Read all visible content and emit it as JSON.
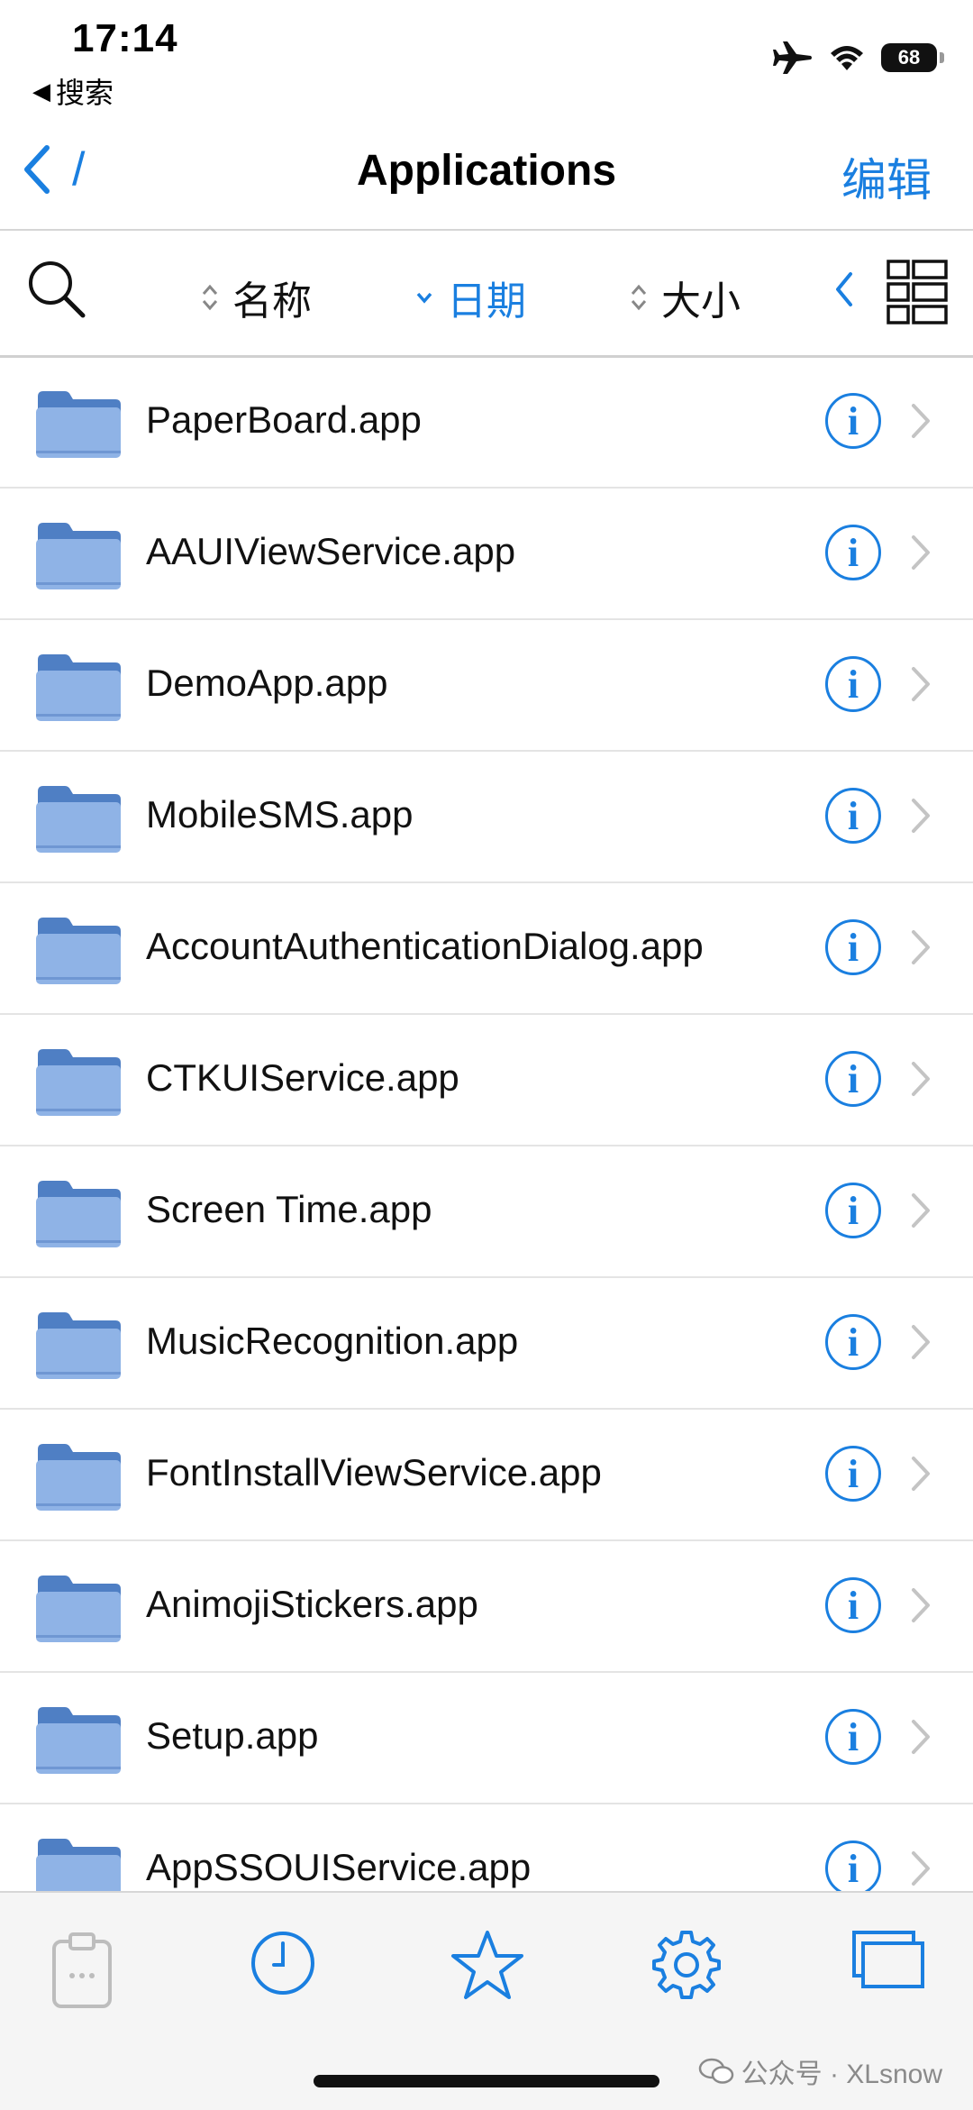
{
  "status_bar": {
    "time": "17:14",
    "back_label": "搜索",
    "battery": "68",
    "icons": [
      "airplane-icon",
      "wifi-icon",
      "battery-icon"
    ]
  },
  "nav": {
    "path": "/",
    "title": "Applications",
    "edit_label": "编辑"
  },
  "sort_bar": {
    "name_label": "名称",
    "date_label": "日期",
    "size_label": "大小",
    "active": "日期"
  },
  "files": [
    {
      "name": "PaperBoard.app"
    },
    {
      "name": "AAUIViewService.app"
    },
    {
      "name": "DemoApp.app"
    },
    {
      "name": "MobileSMS.app"
    },
    {
      "name": "AccountAuthenticationDialog.app"
    },
    {
      "name": "CTKUIService.app"
    },
    {
      "name": "Screen Time.app"
    },
    {
      "name": "MusicRecognition.app"
    },
    {
      "name": "FontInstallViewService.app"
    },
    {
      "name": "AnimojiStickers.app"
    },
    {
      "name": "Setup.app"
    },
    {
      "name": "AppSSOUIService.app"
    }
  ],
  "info_glyph": "i",
  "tab_bar": {
    "tabs": [
      "clipboard-icon",
      "clock-icon",
      "star-icon",
      "gear-icon",
      "windows-icon"
    ]
  },
  "watermark": "公众号 · XLsnow",
  "colors": {
    "accent": "#1a7fe0",
    "folder": "#8fb3e6",
    "folder_tab": "#4f7fc4"
  }
}
